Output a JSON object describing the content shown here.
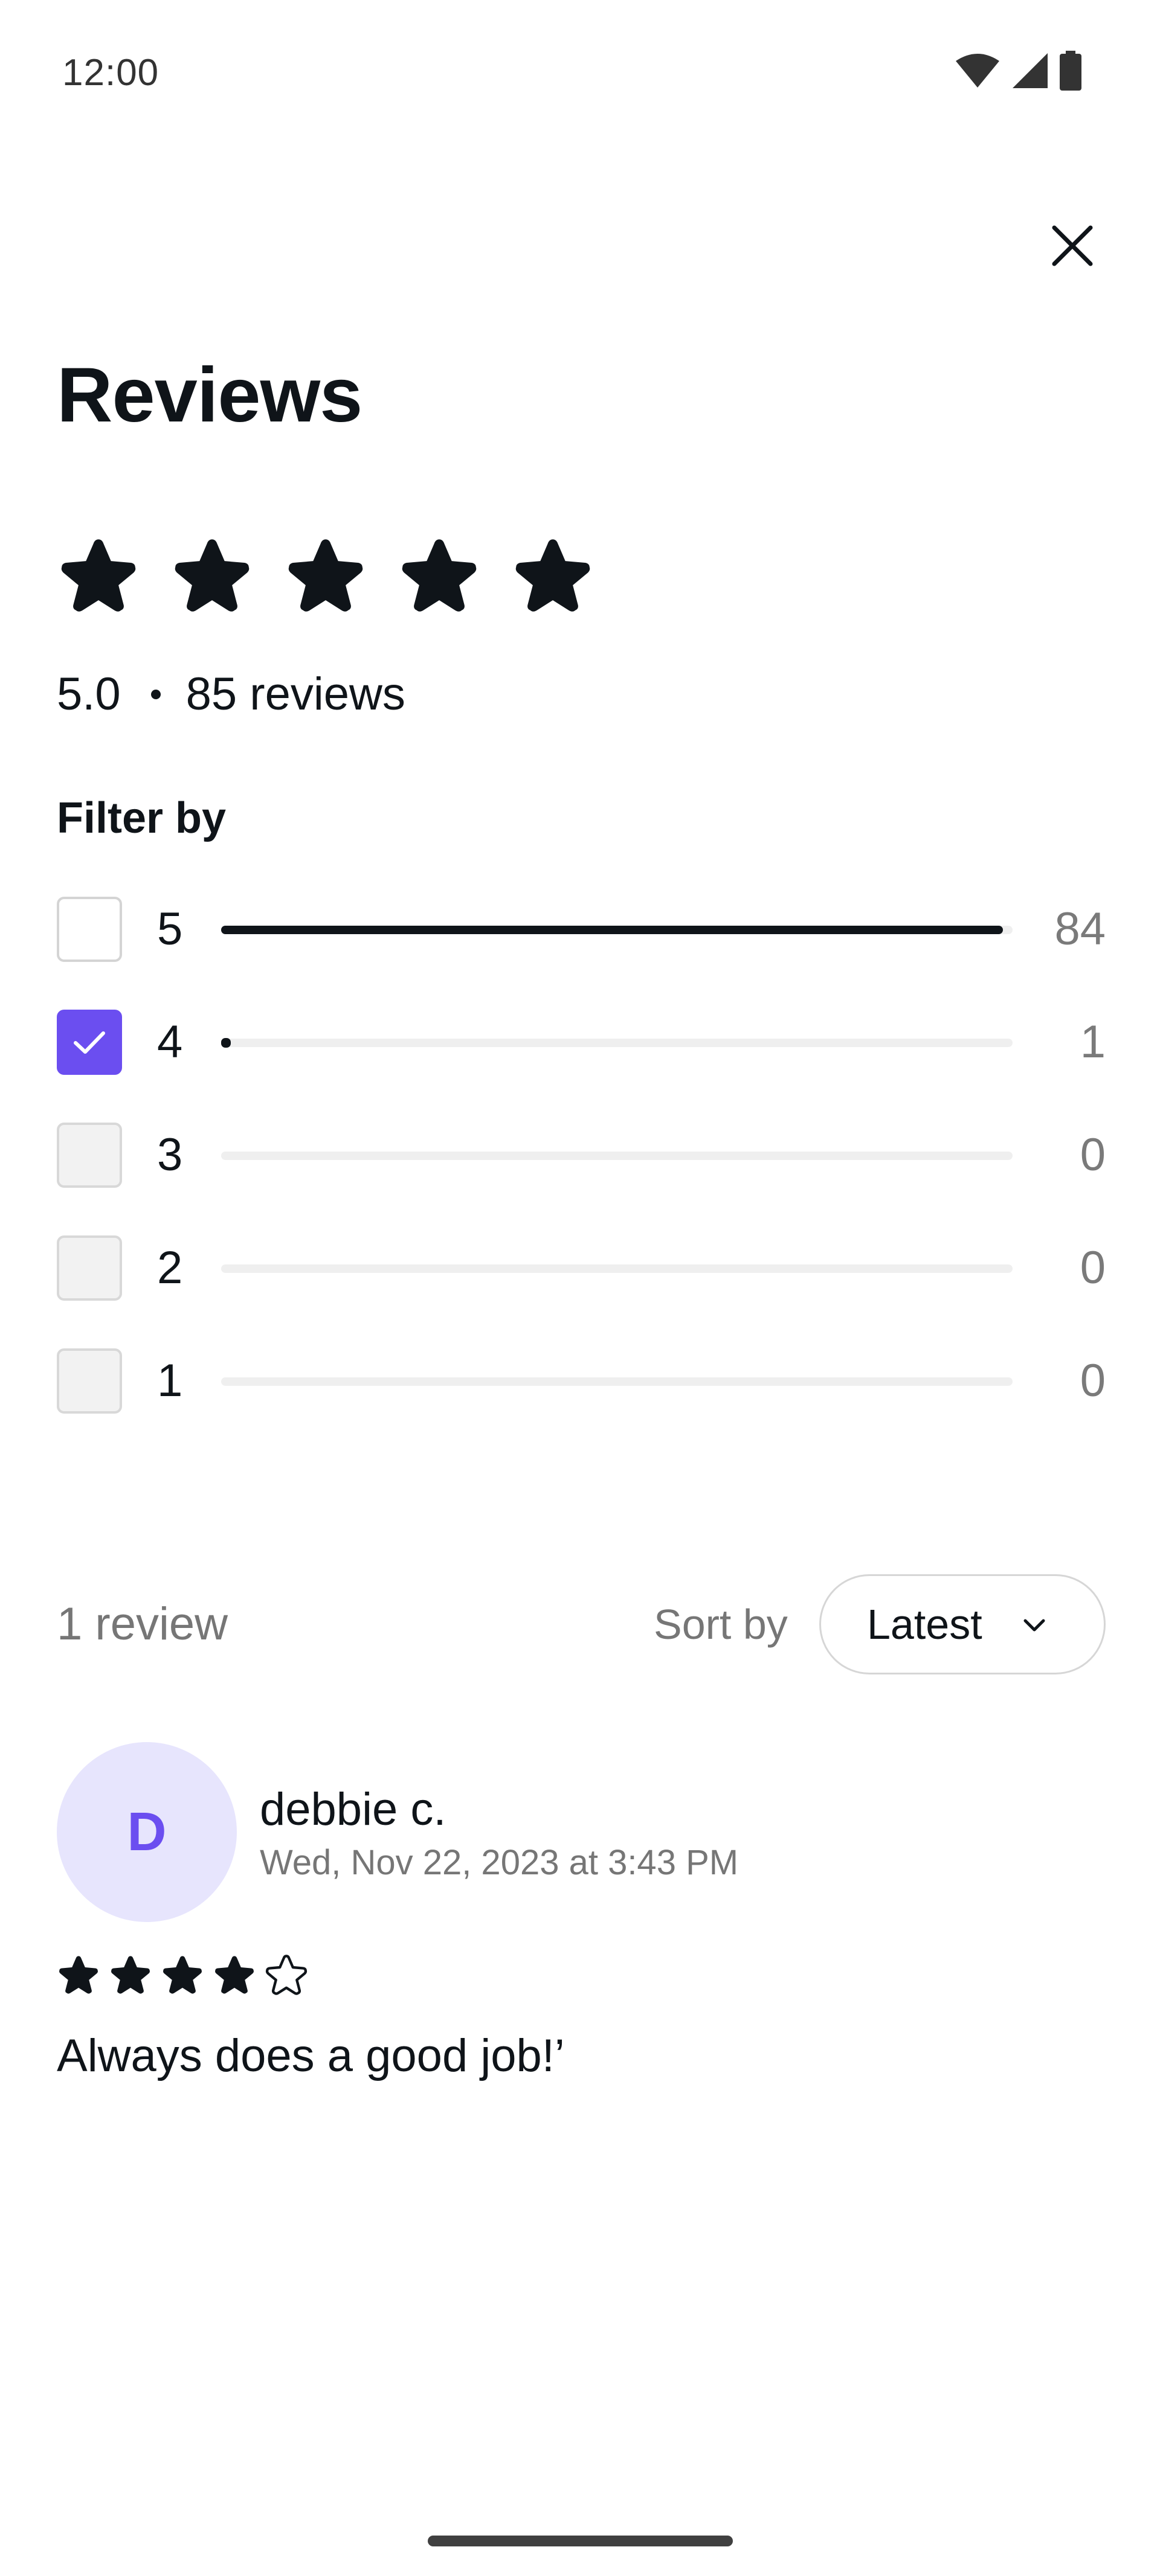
{
  "status_bar": {
    "time": "12:00",
    "icons": [
      "wifi-icon",
      "cell-signal-icon",
      "battery-icon"
    ]
  },
  "header": {
    "close_icon": "close-icon",
    "title": "Reviews"
  },
  "rating": {
    "stars_filled": 5,
    "stars_total": 5,
    "average": "5.0",
    "review_count_label": "85 reviews"
  },
  "filter": {
    "heading": "Filter by",
    "rows": [
      {
        "stars": "5",
        "count": "84",
        "fraction": 0.988,
        "checked": false,
        "disabled": false
      },
      {
        "stars": "4",
        "count": "1",
        "fraction": 0.012,
        "checked": true,
        "disabled": false
      },
      {
        "stars": "3",
        "count": "0",
        "fraction": 0,
        "checked": false,
        "disabled": true
      },
      {
        "stars": "2",
        "count": "0",
        "fraction": 0,
        "checked": false,
        "disabled": true
      },
      {
        "stars": "1",
        "count": "0",
        "fraction": 0,
        "checked": false,
        "disabled": true
      }
    ]
  },
  "results": {
    "count_label": "1 review",
    "sort_label": "Sort by",
    "sort_value": "Latest"
  },
  "reviews": [
    {
      "avatar_initial": "D",
      "author": "debbie c.",
      "date": "Wed, Nov 22, 2023 at 3:43 PM",
      "stars": 4,
      "stars_total": 5,
      "text": "Always does a good job!’"
    }
  ],
  "colors": {
    "accent": "#6b4ef0",
    "avatar_bg": "#e7e5fd",
    "text_primary": "#0f1419",
    "text_secondary": "#767676"
  }
}
